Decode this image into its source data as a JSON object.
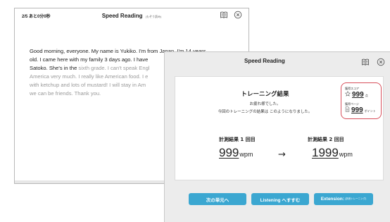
{
  "reading_window": {
    "counter": "2/5 あと0分0秒",
    "title": "Speed Reading",
    "title_sub": "(もぞう読み)",
    "text_lines": [
      {
        "strong": "Good morning, everyone. My name is Yukiko. I'm from Japan. I'm 14 years",
        "dim": ""
      },
      {
        "strong": "old. I came here with my family 3 days ago. I have",
        "dim": ""
      },
      {
        "strong": "Satoko. She's in the ",
        "dim": "sixth grade. I can't speak Engl"
      },
      {
        "strong": "",
        "dim": "America very much. I really like American food. I e"
      },
      {
        "strong": "",
        "dim": "with ketchup and lots of mustard! I will stay in Am"
      },
      {
        "strong": "",
        "dim": "we can be friends. Thank you."
      }
    ],
    "icons": {
      "book": "book-icon",
      "close": "close-icon"
    }
  },
  "results_window": {
    "title": "Speed Reading",
    "heading": "トレーニング結果",
    "message1": "お疲れ様でした。",
    "message2": "今回のトレーニングの結果は このようになりました。",
    "score": {
      "label": "獲得スコア",
      "value": "999",
      "unit": "点",
      "icon": "star-icon"
    },
    "pages": {
      "label": "獲得ページ",
      "value": "999",
      "unit": "ポイント",
      "icon": "page-icon"
    },
    "measure1": {
      "label": "計測結果 1 回目",
      "value": "999",
      "unit": "wpm"
    },
    "arrow": "→",
    "measure2": {
      "label": "計測結果 2 回目",
      "value": "1999",
      "unit": "wpm"
    },
    "buttons": {
      "next": "次の単元へ",
      "listening": "Listening へすすむ",
      "extension": "Extension:",
      "extension_sub": "(多読トレーニング)"
    },
    "icons": {
      "book": "book-icon",
      "close": "close-icon"
    },
    "colors": {
      "button": "#3ba7d1",
      "score_border": "#d8505c"
    }
  }
}
